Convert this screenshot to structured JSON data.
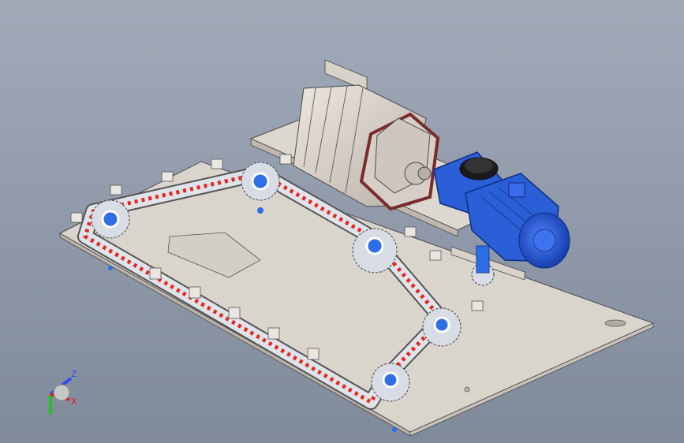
{
  "view": {
    "background_top": "#a2aab8",
    "background_bottom": "#7f8a9b"
  },
  "model": {
    "plate_color": "#d9d4cc",
    "chain_link_color": "#dfe3ea",
    "chain_roller_color": "#e8261c",
    "sprocket_color": "#d8dce4",
    "sprocket_hub_color": "#2e6ee6",
    "motor_color": "#2a5fd8",
    "drum_color": "#cfc7bf",
    "drum_band_color": "#7a2b2b"
  },
  "triad": {
    "z_label": "Z",
    "x_label": "X",
    "z_color": "#2f4cf0",
    "x_color": "#e02020",
    "y_color": "#20c020"
  }
}
